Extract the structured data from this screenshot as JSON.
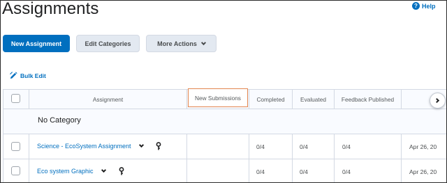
{
  "page": {
    "title": "Assignments"
  },
  "help": {
    "label": "Help"
  },
  "toolbar": {
    "new_assignment": "New Assignment",
    "edit_categories": "Edit Categories",
    "more_actions": "More Actions"
  },
  "bulk_edit": {
    "label": "Bulk Edit"
  },
  "table": {
    "headers": {
      "assignment": "Assignment",
      "new_submissions": "New Submissions",
      "completed": "Completed",
      "evaluated": "Evaluated",
      "feedback_published": "Feedback Published"
    },
    "category": "No Category",
    "rows": [
      {
        "name": "Science - EcoSystem Assignment",
        "completed": "0/4",
        "evaluated": "0/4",
        "feedback": "0/4",
        "due": "Apr 26, 20"
      },
      {
        "name": "Eco system Graphic",
        "completed": "0/4",
        "evaluated": "0/4",
        "feedback": "0/4",
        "due": "Apr 26, 20"
      }
    ]
  },
  "colors": {
    "accent": "#006fbf",
    "highlight_border": "#e2854f"
  }
}
